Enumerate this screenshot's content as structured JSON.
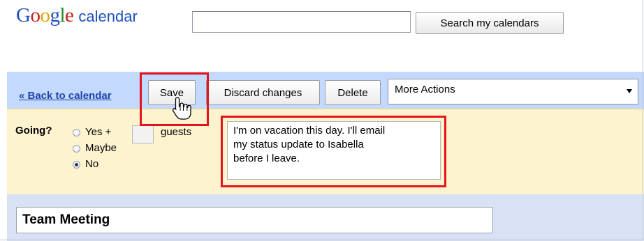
{
  "header": {
    "logo_letters": [
      "G",
      "o",
      "o",
      "g",
      "l",
      "e"
    ],
    "logo_suffix": "calendar",
    "search_placeholder": "",
    "search_button_label": "Search my calendars"
  },
  "toolbar": {
    "back_link_label": "« Back to calendar",
    "save_label": "Save",
    "discard_label": "Discard changes",
    "delete_label": "Delete",
    "more_actions_selected": "More Actions"
  },
  "rsvp": {
    "going_label": "Going?",
    "yes_label": "Yes +",
    "guests_label": "guests",
    "maybe_label": "Maybe",
    "no_label": "No",
    "selected": "No",
    "comment_lines": [
      "I'm on vacation this day. I'll email",
      "my status update to Isabella",
      "before I leave."
    ]
  },
  "event": {
    "title": "Team Meeting"
  },
  "colors": {
    "toolbar_bg": "#c3d9ff",
    "rsvp_bg": "#fdf3cf",
    "highlight_red": "#e5141b",
    "link_blue": "#1f44a8"
  }
}
